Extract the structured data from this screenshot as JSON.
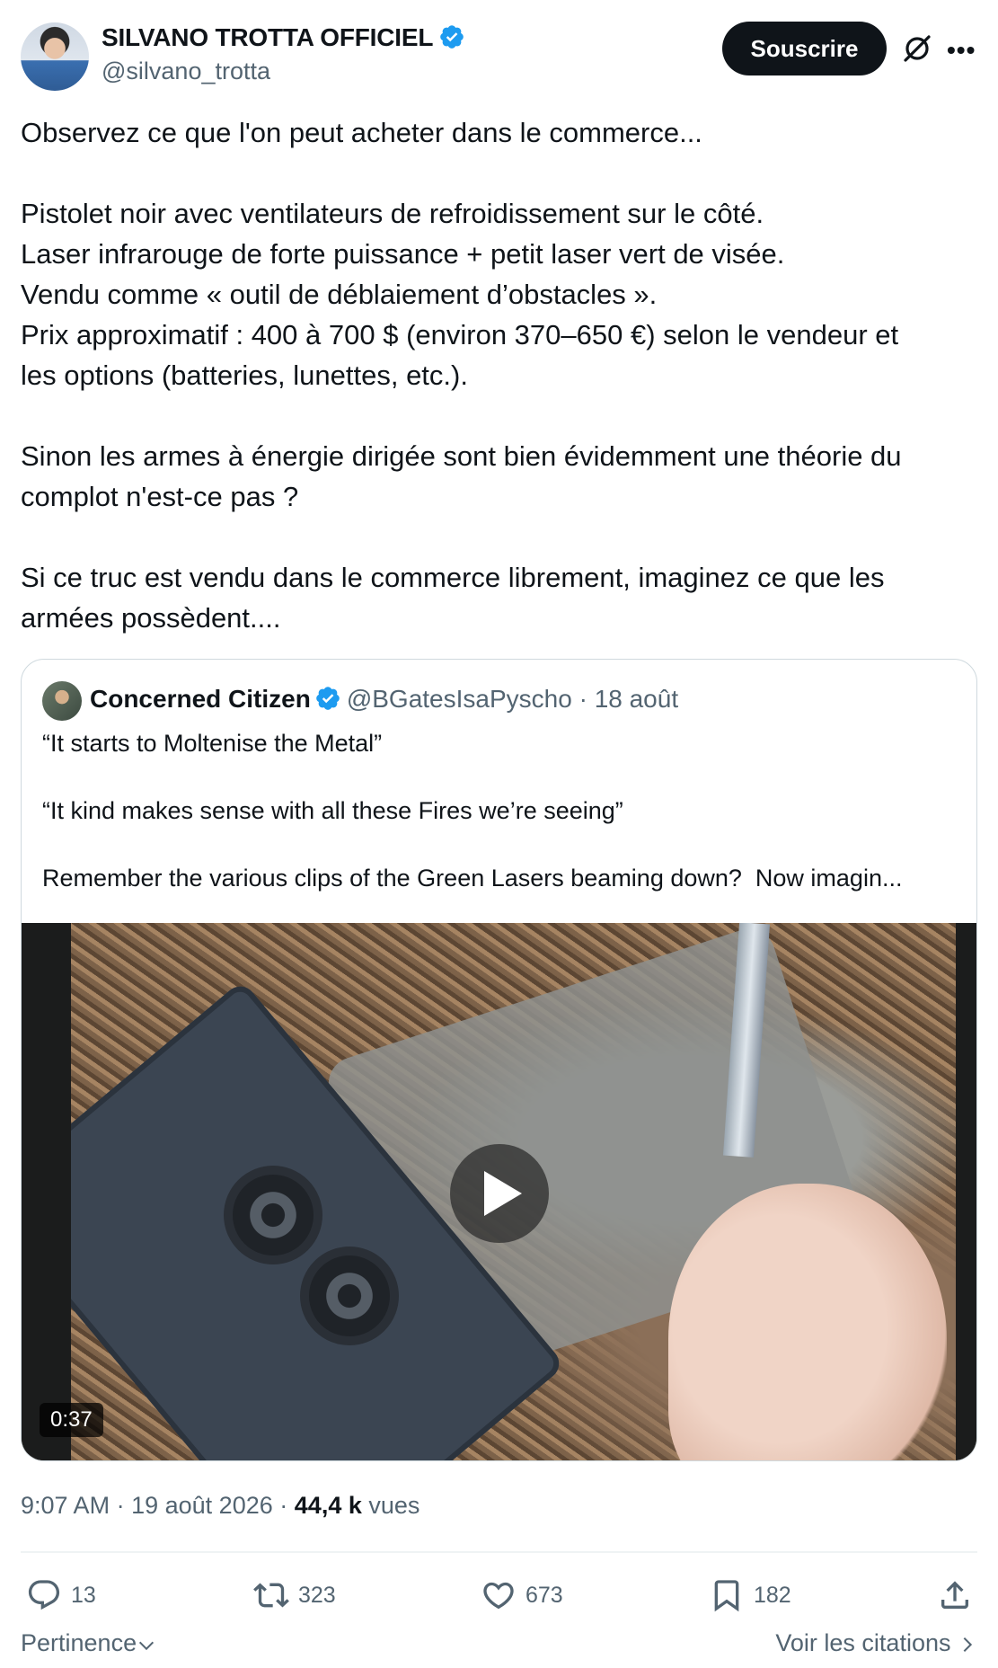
{
  "author": {
    "name": "SILVANO TROTTA OFFICIEL",
    "handle": "@silvano_trotta"
  },
  "header": {
    "subscribe_label": "Souscrire",
    "grok_icon": "grok-icon",
    "more_icon": "more-icon"
  },
  "tweet": {
    "paragraphs": [
      "Observez ce que l'on peut acheter dans le commerce...",
      "Pistolet noir avec ventilateurs de refroidissement sur le côté.\nLaser infrarouge de forte puissance + petit laser vert de visée.\nVendu comme « outil de déblaiement d’obstacles ».\nPrix approximatif : 400 à 700 $ (environ 370–650 €) selon le vendeur et\nles options (batteries, lunettes, etc.).",
      "Sinon les armes à énergie dirigée sont bien évidemment une théorie du\ncomplot n'est-ce pas ?",
      "Si ce truc est vendu dans le commerce librement, imaginez ce que les\narmées possèdent...."
    ]
  },
  "quote": {
    "name": "Concerned Citizen",
    "handle": "@BGatesIsaPyscho",
    "separator": "·",
    "date": "18 août",
    "paragraphs": [
      "“It starts to Moltenise the Metal”",
      "“It kind makes sense with all these Fires we’re seeing”",
      "Remember the various clips of the Green Lasers beaming down?  Now imagin..."
    ],
    "video": {
      "duration": "0:37"
    }
  },
  "meta": {
    "time": "9:07 AM",
    "dot": "·",
    "date": "19 août 2026",
    "views": "44,4 k",
    "views_label": "vues"
  },
  "actions": {
    "replies": "13",
    "retweets": "323",
    "likes": "673",
    "bookmarks": "182"
  },
  "footer": {
    "relevance_label": "Pertinence",
    "quotes_label": "Voir les citations"
  },
  "colors": {
    "text": "#0f1419",
    "secondary": "#536471",
    "verified": "#1d9bf0",
    "border": "#cfd9de"
  }
}
